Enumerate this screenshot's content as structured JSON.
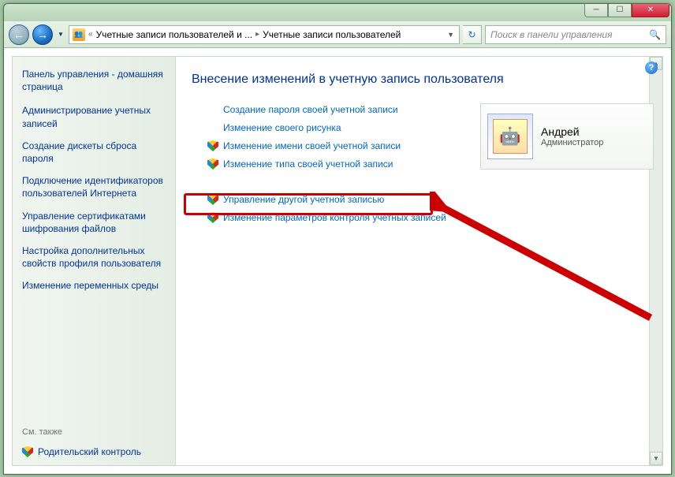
{
  "window": {
    "min_glyph": "─",
    "max_glyph": "☐",
    "close_glyph": "✕"
  },
  "toolbar": {
    "back_glyph": "←",
    "fwd_glyph": "→",
    "drop_glyph": "▼",
    "breadcrumb_prefix": "«",
    "breadcrumb_seg1": "Учетные записи пользователей и ...",
    "breadcrumb_sep": "▸",
    "breadcrumb_seg2": "Учетные записи пользователей",
    "refresh_glyph": "↻",
    "search_placeholder": "Поиск в панели управления",
    "search_icon": "🔍"
  },
  "help_glyph": "?",
  "sidebar": {
    "home": "Панель управления - домашняя страница",
    "links": [
      "Администрирование учетных записей",
      "Создание дискеты сброса пароля",
      "Подключение идентификаторов пользователей Интернета",
      "Управление сертификатами шифрования файлов",
      "Настройка дополнительных свойств профиля пользователя",
      "Изменение переменных среды"
    ],
    "see_also": "См. также",
    "parental": "Родительский контроль"
  },
  "main": {
    "heading": "Внесение изменений в учетную запись пользователя",
    "tasks": [
      {
        "shield": false,
        "label": "Создание пароля своей учетной записи"
      },
      {
        "shield": false,
        "label": "Изменение своего рисунка"
      },
      {
        "shield": true,
        "label": "Изменение имени своей учетной записи"
      },
      {
        "shield": true,
        "label": "Изменение типа своей учетной записи"
      }
    ],
    "tasks2": [
      {
        "shield": true,
        "label": "Управление другой учетной записью"
      },
      {
        "shield": true,
        "label": "Изменение параметров контроля учетных записей"
      }
    ]
  },
  "user": {
    "name": "Андрей",
    "role": "Администратор",
    "avatar_glyph": "🤖"
  },
  "scrollbar": {
    "up": "▲",
    "down": "▼"
  }
}
